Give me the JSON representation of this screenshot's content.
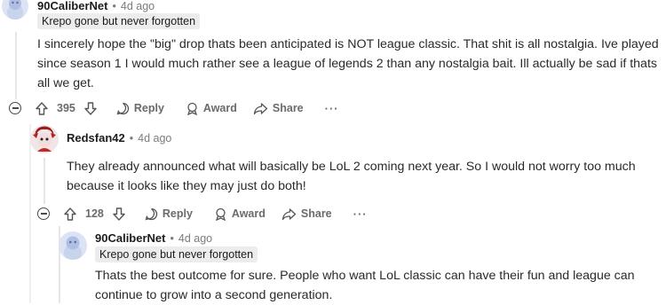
{
  "comments": [
    {
      "username": "90CaliberNet",
      "time": "4d ago",
      "flair": "Krepo gone but never forgotten",
      "body_lines": [
        "I sincerely hope the \"big\" drop thats been anticipated is NOT league classic. That shit is all nostalgia. Ive played",
        "since season 1 I would much rather see a league of legends 2 than any nostalgia bait. Ill actually be sad if thats",
        "all we get."
      ],
      "votes": "395",
      "reply_label": "Reply",
      "award_label": "Award",
      "share_label": "Share",
      "more_label": "···"
    },
    {
      "username": "Redsfan42",
      "time": "4d ago",
      "body_lines": [
        "They already announced what will basically be LoL 2 coming next year. So I would not worry too much",
        "because it looks like they may just do both!"
      ],
      "votes": "128",
      "reply_label": "Reply",
      "award_label": "Award",
      "share_label": "Share",
      "more_label": "···"
    },
    {
      "username": "90CaliberNet",
      "time": "4d ago",
      "flair": "Krepo gone but never forgotten",
      "body_lines": [
        "Thats the best outcome for sure. People who want LoL classic can have their fun and league can",
        "continue to grow into a second generation."
      ]
    }
  ],
  "separator": "•",
  "colors": {
    "muted": "#7c7c7c",
    "flair_bg": "#ececec",
    "thread_line": "#e6e6e6"
  }
}
